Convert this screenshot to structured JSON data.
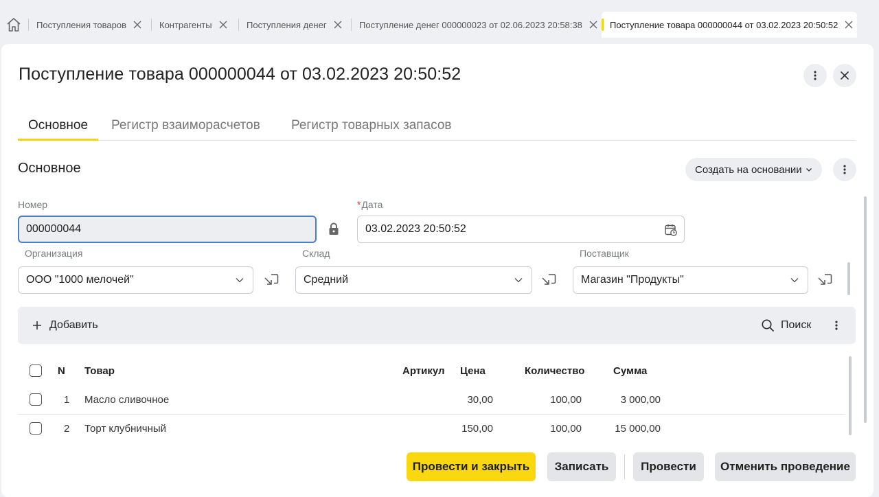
{
  "tabs": [
    {
      "label": "Поступления товаров"
    },
    {
      "label": "Контрагенты"
    },
    {
      "label": "Поступления денег"
    },
    {
      "label": "Поступление денег 000000023 от 02.06.2023 20:58:38"
    },
    {
      "label": "Поступление товара 000000044 от 03.02.2023 20:50:52"
    }
  ],
  "document": {
    "title": "Поступление товара 000000044 от 03.02.2023 20:50:52"
  },
  "sub_tabs": [
    {
      "label": "Основное"
    },
    {
      "label": "Регистр взаиморасчетов"
    },
    {
      "label": "Регистр товарных запасов"
    }
  ],
  "section": {
    "title": "Основное",
    "create_based_on": "Создать на основании"
  },
  "fields": {
    "number": {
      "label": "Номер",
      "value": "000000044"
    },
    "date": {
      "required_mark": "*",
      "label": "Дата",
      "value": "03.02.2023 20:50:52"
    },
    "organization": {
      "label": "Организация",
      "value": "ООО \"1000 мелочей\""
    },
    "warehouse": {
      "label": "Склад",
      "value": "Средний"
    },
    "supplier": {
      "label": "Поставщик",
      "value": "Магазин \"Продукты\""
    }
  },
  "toolbar": {
    "add_label": "Добавить",
    "search_label": "Поиск"
  },
  "table": {
    "columns": [
      "N",
      "Товар",
      "Артикул",
      "Цена",
      "Количество",
      "Сумма"
    ],
    "rows": [
      {
        "n": "1",
        "product": "Масло сливочное",
        "article": "",
        "price": "30,00",
        "qty": "100,00",
        "sum": "3 000,00"
      },
      {
        "n": "2",
        "product": "Торт клубничный",
        "article": "",
        "price": "150,00",
        "qty": "100,00",
        "sum": "15 000,00"
      }
    ]
  },
  "buttons": {
    "post_and_close": "Провести и закрыть",
    "save": "Записать",
    "post": "Провести",
    "cancel_posting": "Отменить проведение"
  },
  "colors": {
    "accent": "#fad70f",
    "focus_border": "#4a7ec7",
    "required": "#dd3333"
  }
}
